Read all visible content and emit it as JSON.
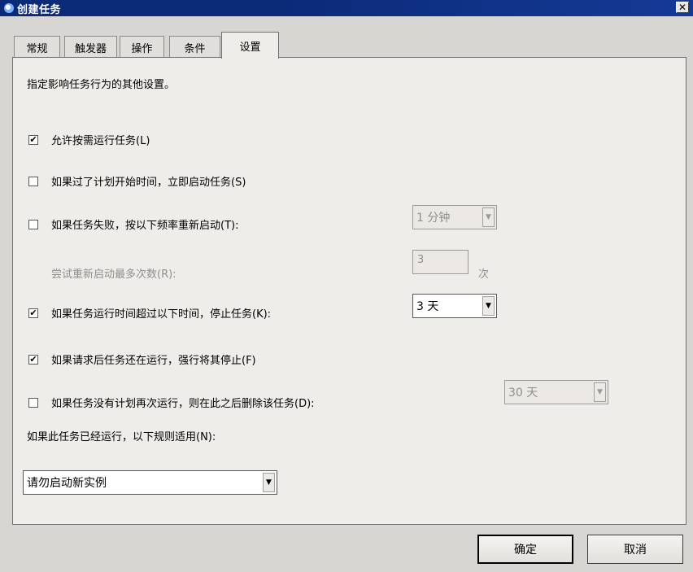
{
  "window": {
    "title": "创建任务",
    "close_glyph": "✕"
  },
  "tabs": [
    {
      "label": "常规"
    },
    {
      "label": "触发器"
    },
    {
      "label": "操作"
    },
    {
      "label": "条件"
    },
    {
      "label": "设置"
    }
  ],
  "active_tab": "设置",
  "settings": {
    "description": "指定影响任务行为的其他设置。",
    "allow_demand_start": {
      "label": "允许按需运行任务(L)",
      "checked": true
    },
    "start_when_missed": {
      "label": "如果过了计划开始时间，立即启动任务(S)",
      "checked": false
    },
    "restart_on_failure": {
      "label": "如果任务失败，按以下频率重新启动(T):",
      "checked": false,
      "interval": "1 分钟"
    },
    "restart_attempts": {
      "label": "尝试重新启动最多次数(R):",
      "value": "3",
      "unit": "次"
    },
    "stop_if_runs_longer": {
      "label": "如果任务运行时间超过以下时间，停止任务(K):",
      "checked": true,
      "duration": "3 天"
    },
    "force_stop": {
      "label": "如果请求后任务还在运行，强行将其停止(F)",
      "checked": true
    },
    "delete_if_not_scheduled": {
      "label": "如果任务没有计划再次运行，则在此之后删除该任务(D):",
      "checked": false,
      "duration": "30 天"
    },
    "existing_instance_rule": {
      "label": "如果此任务已经运行，以下规则适用(N):",
      "value": "请勿启动新实例"
    }
  },
  "buttons": {
    "ok": "确定",
    "cancel": "取消"
  },
  "glyphs": {
    "check": "✔",
    "dropdown": "▼"
  }
}
